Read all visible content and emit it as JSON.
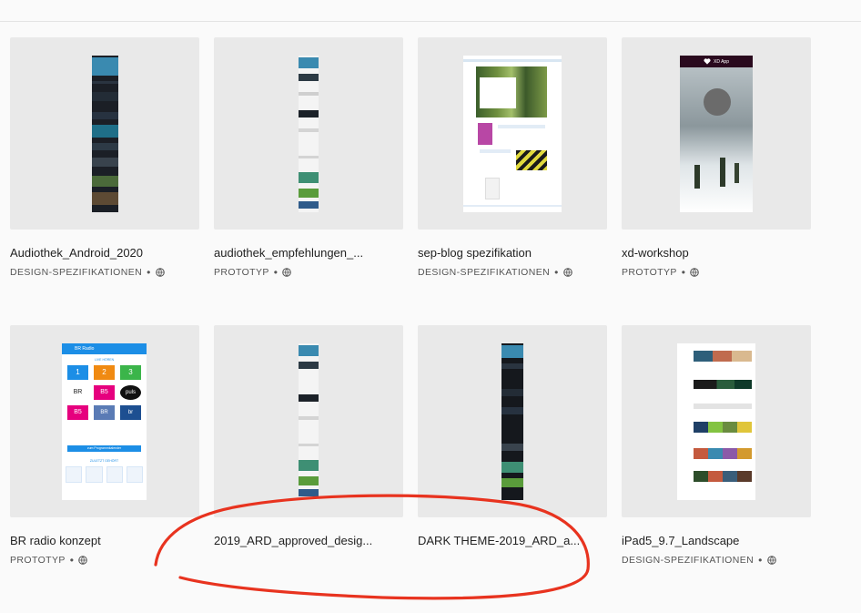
{
  "items": [
    {
      "title": "Audiothek_Android_2020",
      "type": "DESIGN-SPEZIFIKATIONEN"
    },
    {
      "title": "audiothek_empfehlungen_...",
      "type": "PROTOTYP"
    },
    {
      "title": "sep-blog spezifikation",
      "type": "DESIGN-SPEZIFIKATIONEN"
    },
    {
      "title": "xd-workshop",
      "type": "PROTOTYP"
    },
    {
      "title": "BR radio konzept",
      "type": "PROTOTYP"
    },
    {
      "title": "2019_ARD_approved_desig...",
      "type": ""
    },
    {
      "title": "DARK THEME-2019_ARD_a...",
      "type": ""
    },
    {
      "title": "iPad5_9.7_Landscape",
      "type": "DESIGN-SPEZIFIKATIONEN"
    }
  ],
  "separator": "•",
  "icons": {
    "visibility": "globe-icon",
    "xd_app": "heart-icon"
  },
  "thumbs": {
    "xd_app_title": "XD App",
    "br_radio_header": "BR Radio",
    "br_radio_live": "LIVE HÖREN",
    "br_radio_button": "zum Programmkalender",
    "br_radio_recent": "ZULETZT GEHÖRT",
    "br_logos": [
      "1",
      "2",
      "3",
      "BR",
      "B5",
      "puls",
      "B5",
      "BR",
      "br"
    ]
  },
  "colors": {
    "annotation": "#e8331f",
    "br_blue": "#1c8ee6",
    "xd_header": "#2a0a1e"
  }
}
